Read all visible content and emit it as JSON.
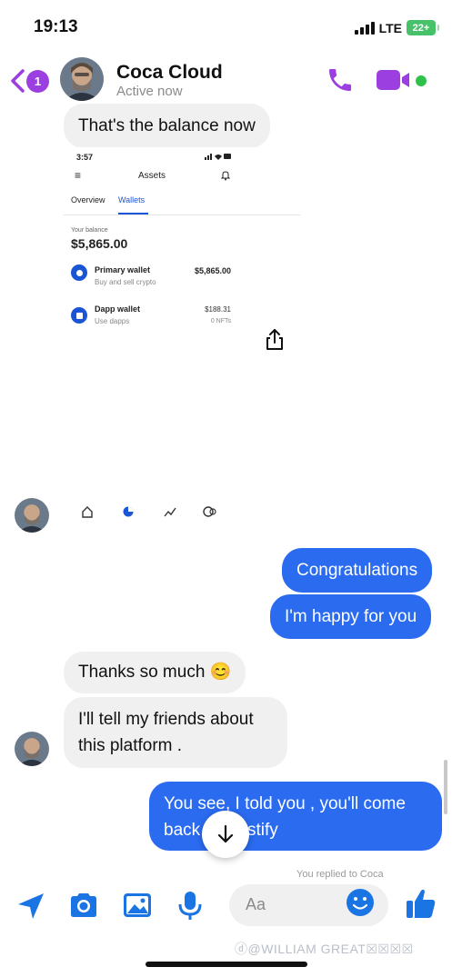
{
  "status_bar": {
    "time": "19:13",
    "network": "LTE",
    "battery": "22+"
  },
  "header": {
    "unread_count": "1",
    "contact_name": "Coca Cloud",
    "presence": "Active now",
    "online_color": "#2fc24a",
    "accent_color": "#9c3fe0"
  },
  "messages": [
    {
      "side": "in",
      "text": "That's the balance now"
    },
    {
      "side": "out",
      "text": "Congratulations"
    },
    {
      "side": "out",
      "text": "I'm happy for you"
    },
    {
      "side": "in",
      "text": "Thanks so much 😊"
    },
    {
      "side": "in",
      "text": "I'll tell my friends about this platform ."
    },
    {
      "side": "out",
      "text": "You see, I told you , you'll come back",
      "tail": "stify"
    }
  ],
  "shared_screenshot": {
    "time": "3:57",
    "title": "Assets",
    "tabs": [
      "Overview",
      "Wallets"
    ],
    "active_tab": "Wallets",
    "balance_label": "Your balance",
    "balance": "$5,865.00",
    "wallets": [
      {
        "name": "Primary wallet",
        "subtitle": "Buy and sell crypto",
        "value": "$5,865.00",
        "detail": ""
      },
      {
        "name": "Dapp wallet",
        "subtitle": "Use dapps",
        "value": "$188.31",
        "detail": "0 NFTs"
      }
    ]
  },
  "replied_note": "You replied to Coca",
  "composer": {
    "placeholder": "Aa"
  },
  "watermark": "ⓓ@WILLIAM GREAT☒☒☒☒",
  "colors": {
    "outgoing_bubble": "#2a6bf0",
    "incoming_bubble": "#f0f0f0",
    "icon_blue": "#1b74e4"
  }
}
